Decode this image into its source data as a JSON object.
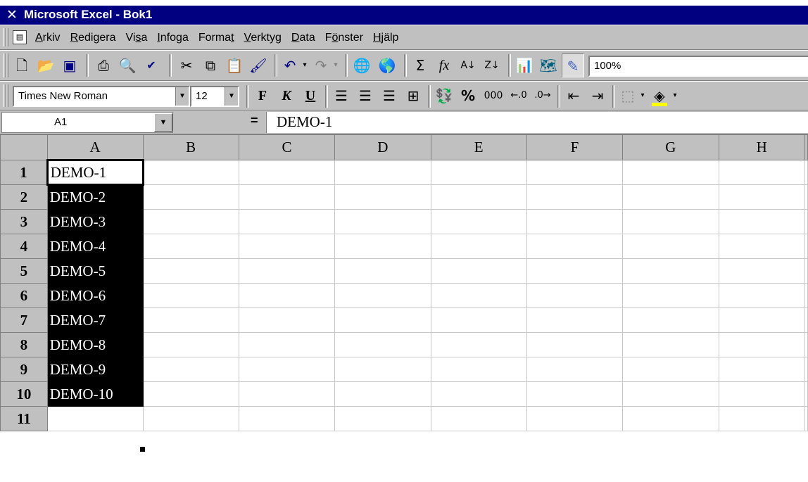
{
  "window": {
    "title": "Microsoft Excel - Bok1"
  },
  "menu": {
    "items": [
      {
        "pre": "",
        "key": "A",
        "post": "rkiv"
      },
      {
        "pre": "",
        "key": "R",
        "post": "edigera"
      },
      {
        "pre": "Vi",
        "key": "s",
        "post": "a"
      },
      {
        "pre": "",
        "key": "I",
        "post": "nfoga"
      },
      {
        "pre": "Forma",
        "key": "t",
        "post": ""
      },
      {
        "pre": "",
        "key": "V",
        "post": "erktyg"
      },
      {
        "pre": "",
        "key": "D",
        "post": "ata"
      },
      {
        "pre": "F",
        "key": "ö",
        "post": "nster"
      },
      {
        "pre": "",
        "key": "H",
        "post": "jälp"
      }
    ]
  },
  "standard_toolbar": {
    "zoom": "100%"
  },
  "formatting_toolbar": {
    "font": "Times New Roman",
    "size": "12",
    "bold": "F",
    "italic": "K",
    "underline": "U",
    "percent": "%",
    "thousands": "000"
  },
  "formula_bar": {
    "name_box": "A1",
    "equals": "=",
    "content": "DEMO-1"
  },
  "sheet": {
    "columns": [
      "A",
      "B",
      "C",
      "D",
      "E",
      "F",
      "G",
      "H"
    ],
    "rows": [
      {
        "num": "1",
        "a": "DEMO-1"
      },
      {
        "num": "2",
        "a": "DEMO-2"
      },
      {
        "num": "3",
        "a": "DEMO-3"
      },
      {
        "num": "4",
        "a": "DEMO-4"
      },
      {
        "num": "5",
        "a": "DEMO-5"
      },
      {
        "num": "6",
        "a": "DEMO-6"
      },
      {
        "num": "7",
        "a": "DEMO-7"
      },
      {
        "num": "8",
        "a": "DEMO-8"
      },
      {
        "num": "9",
        "a": "DEMO-9"
      },
      {
        "num": "10",
        "a": "DEMO-10"
      },
      {
        "num": "11",
        "a": ""
      }
    ]
  }
}
